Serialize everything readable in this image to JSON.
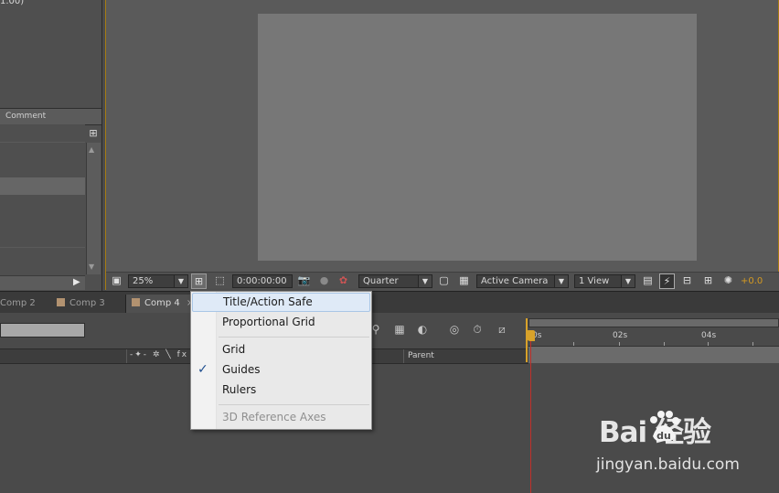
{
  "project": {
    "info_fragment": "1.00)",
    "column_comment": "Comment"
  },
  "viewer_toolbar": {
    "zoom": "25%",
    "timecode": "0:00:00:00",
    "resolution": "Quarter",
    "camera": "Active Camera",
    "views": "1 View",
    "exposure": "+0.0"
  },
  "tabs": [
    {
      "label": "Comp 2"
    },
    {
      "label": "Comp 3"
    },
    {
      "label": "Comp 4"
    }
  ],
  "tab_close": "×",
  "timeline": {
    "parent_header": "Parent",
    "ruler_labels": [
      "0s",
      "02s",
      "04s"
    ]
  },
  "menu": {
    "items": [
      {
        "label": "Title/Action Safe",
        "highlighted": true
      },
      {
        "label": "Proportional Grid"
      },
      {
        "label": "Grid"
      },
      {
        "label": "Guides",
        "checked": true
      },
      {
        "label": "Rulers"
      },
      {
        "label": "3D Reference Axes",
        "disabled": true
      }
    ],
    "checkmark": "✓"
  },
  "watermark": {
    "logo_text": "Bai  经验",
    "url": "jingyan.baidu.com"
  },
  "colors": {
    "viewer_border": "#a67c12",
    "cti": "#c0302a",
    "exposure": "#d49a22"
  }
}
